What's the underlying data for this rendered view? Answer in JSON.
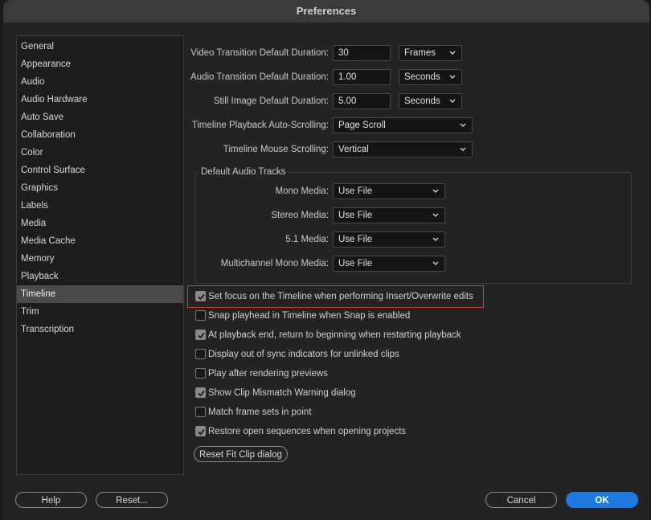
{
  "window": {
    "title": "Preferences"
  },
  "sidebar": {
    "items": [
      {
        "label": "General"
      },
      {
        "label": "Appearance"
      },
      {
        "label": "Audio"
      },
      {
        "label": "Audio Hardware"
      },
      {
        "label": "Auto Save"
      },
      {
        "label": "Collaboration"
      },
      {
        "label": "Color"
      },
      {
        "label": "Control Surface"
      },
      {
        "label": "Graphics"
      },
      {
        "label": "Labels"
      },
      {
        "label": "Media"
      },
      {
        "label": "Media Cache"
      },
      {
        "label": "Memory"
      },
      {
        "label": "Playback"
      },
      {
        "label": "Timeline"
      },
      {
        "label": "Trim"
      },
      {
        "label": "Transcription"
      }
    ],
    "selected": "Timeline"
  },
  "durations": {
    "video": {
      "label": "Video Transition Default Duration:",
      "value": "30",
      "unit": "Frames"
    },
    "audio": {
      "label": "Audio Transition Default Duration:",
      "value": "1.00",
      "unit": "Seconds"
    },
    "still": {
      "label": "Still Image Default Duration:",
      "value": "5.00",
      "unit": "Seconds"
    }
  },
  "scrolling": {
    "auto": {
      "label": "Timeline Playback Auto-Scrolling:",
      "value": "Page Scroll"
    },
    "mouse": {
      "label": "Timeline Mouse Scrolling:",
      "value": "Vertical"
    }
  },
  "audio_tracks": {
    "title": "Default Audio Tracks",
    "mono": {
      "label": "Mono Media:",
      "value": "Use File"
    },
    "stereo": {
      "label": "Stereo Media:",
      "value": "Use File"
    },
    "surround": {
      "label": "5.1 Media:",
      "value": "Use File"
    },
    "multichannel": {
      "label": "Multichannel Mono Media:",
      "value": "Use File"
    }
  },
  "options": [
    {
      "label": "Set focus on the Timeline when performing Insert/Overwrite edits",
      "checked": true
    },
    {
      "label": "Snap playhead in Timeline when Snap is enabled",
      "checked": false
    },
    {
      "label": "At playback end, return to beginning when restarting playback",
      "checked": true
    },
    {
      "label": "Display out of sync indicators for unlinked clips",
      "checked": false
    },
    {
      "label": "Play after rendering previews",
      "checked": false
    },
    {
      "label": "Show Clip Mismatch Warning dialog",
      "checked": true
    },
    {
      "label": "Match frame sets in point",
      "checked": false
    },
    {
      "label": "Restore open sequences when opening projects",
      "checked": true
    }
  ],
  "buttons": {
    "reset_fit_clip": "Reset Fit Clip dialog",
    "help": "Help",
    "reset": "Reset...",
    "cancel": "Cancel",
    "ok": "OK"
  },
  "colors": {
    "accent": "#1f7ae0",
    "highlight": "#d23b3b",
    "selected_item": "#4a4a4a"
  }
}
